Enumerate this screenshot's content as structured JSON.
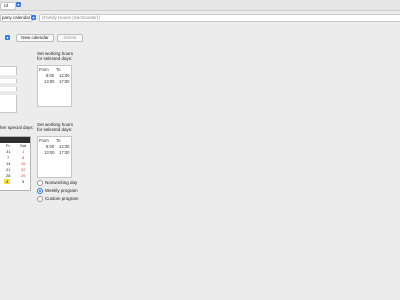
{
  "topbar": {
    "field_tail": "rd"
  },
  "header": {
    "calendar_select": "pany calendar",
    "family_name": "(Family House (Sectrooster))"
  },
  "toolbar": {
    "new_calendar": "New calendar",
    "delete": "Delete"
  },
  "section1": {
    "title_line1": "Set working hours",
    "title_line2": "for selected days:",
    "col_from": "From",
    "col_to": "To",
    "rows": [
      [
        "8:00",
        "12:00"
      ],
      [
        "13:00",
        "17:00"
      ]
    ]
  },
  "section2": {
    "left_label": "her special days:",
    "title_line1": "Set working hours",
    "title_line2": "for selected days:",
    "col_from": "From",
    "col_to": "To",
    "rows": [
      [
        "8:00",
        "12:00"
      ],
      [
        "13:00",
        "17:00"
      ]
    ]
  },
  "calendar": {
    "headers": [
      "Fr",
      "Sat"
    ],
    "rows": [
      [
        "31",
        "1"
      ],
      [
        "7",
        "8"
      ],
      [
        "14",
        "15"
      ],
      [
        "21",
        "22"
      ],
      [
        "28",
        "29"
      ],
      [
        "4",
        "5"
      ]
    ]
  },
  "options": {
    "nonworking": "Nonworking day",
    "weekly": "Weekly program",
    "custom": "Custom program",
    "selected": "weekly"
  }
}
